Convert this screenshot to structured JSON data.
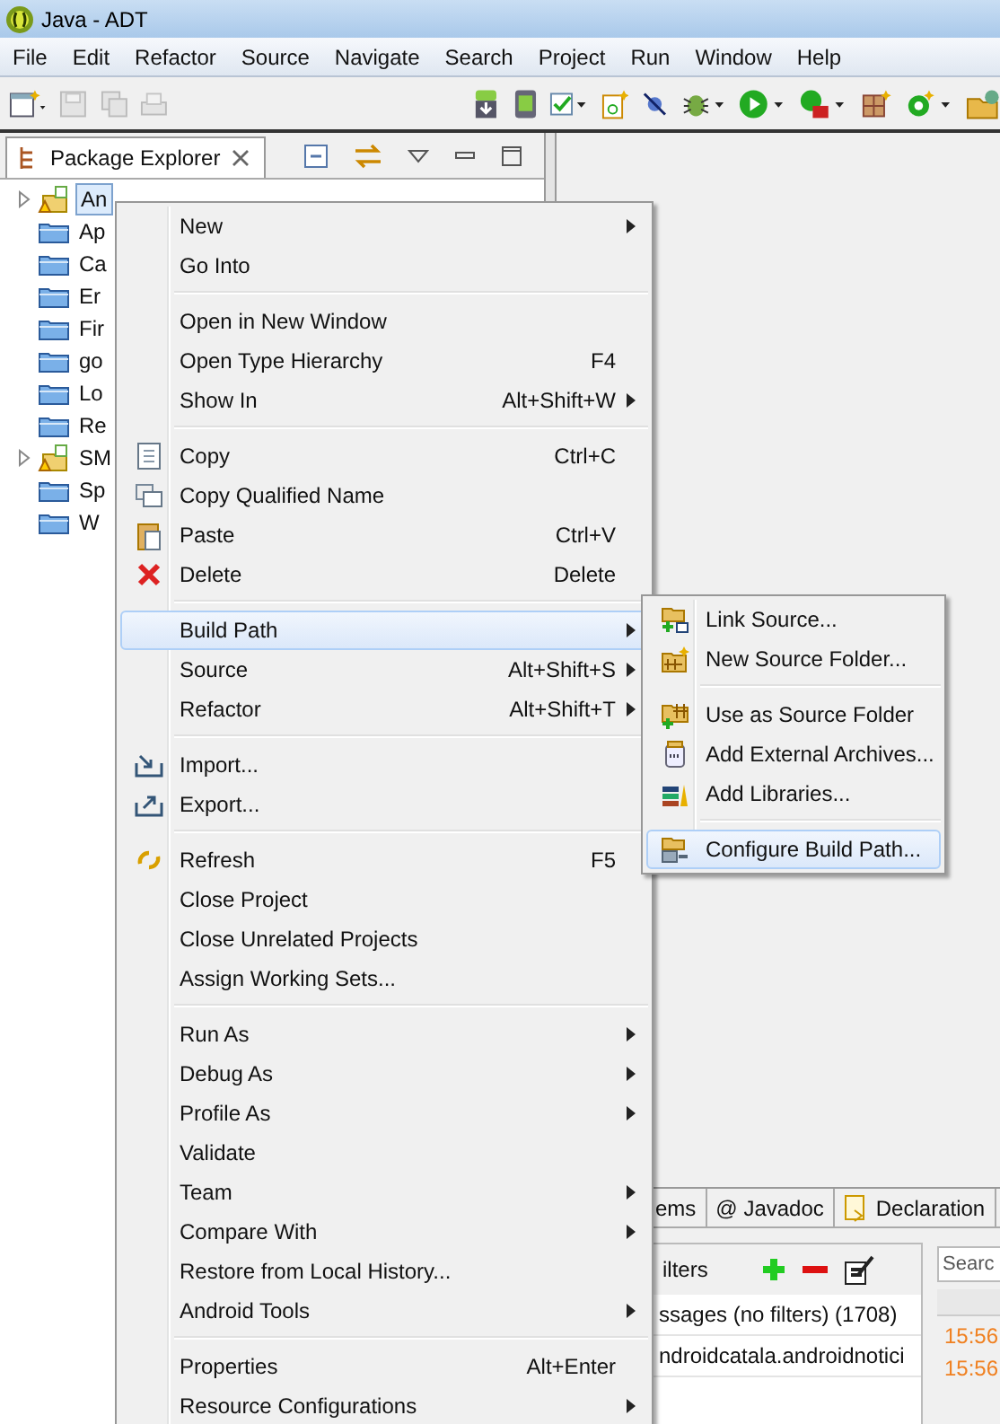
{
  "window": {
    "title": "Java - ADT"
  },
  "menu_bar": [
    "File",
    "Edit",
    "Refactor",
    "Source",
    "Navigate",
    "Search",
    "Project",
    "Run",
    "Window",
    "Help"
  ],
  "package_explorer": {
    "title": "Package Explorer",
    "items": [
      {
        "label": "An",
        "kind": "project",
        "expandable": true,
        "selected": true
      },
      {
        "label": "Ap",
        "kind": "folder",
        "expandable": false,
        "selected": false
      },
      {
        "label": "Ca",
        "kind": "folder",
        "expandable": false,
        "selected": false
      },
      {
        "label": "Er",
        "kind": "folder",
        "expandable": false,
        "selected": false
      },
      {
        "label": "Fir",
        "kind": "folder",
        "expandable": false,
        "selected": false
      },
      {
        "label": "go",
        "kind": "folder",
        "expandable": false,
        "selected": false
      },
      {
        "label": "Lo",
        "kind": "folder",
        "expandable": false,
        "selected": false
      },
      {
        "label": "Re",
        "kind": "folder",
        "expandable": false,
        "selected": false
      },
      {
        "label": "SM",
        "kind": "project",
        "expandable": true,
        "selected": false
      },
      {
        "label": "Sp",
        "kind": "folder",
        "expandable": false,
        "selected": false
      },
      {
        "label": "W",
        "kind": "folder",
        "expandable": false,
        "selected": false
      }
    ]
  },
  "context_menu": [
    [
      {
        "label": "New",
        "submenu": true,
        "selected": false
      },
      {
        "label": "Go Into",
        "submenu": false,
        "selected": false
      }
    ],
    [
      {
        "label": "Open in New Window",
        "submenu": false,
        "selected": false
      },
      {
        "label": "Open Type Hierarchy",
        "shortcut": "F4",
        "submenu": false,
        "selected": false
      },
      {
        "label": "Show In",
        "shortcut": "Alt+Shift+W",
        "submenu": true,
        "selected": false
      }
    ],
    [
      {
        "label": "Copy",
        "shortcut": "Ctrl+C",
        "submenu": false,
        "selected": false
      },
      {
        "label": "Copy Qualified Name",
        "submenu": false,
        "selected": false
      },
      {
        "label": "Paste",
        "shortcut": "Ctrl+V",
        "submenu": false,
        "selected": false
      },
      {
        "label": "Delete",
        "shortcut": "Delete",
        "submenu": false,
        "selected": false
      }
    ],
    [
      {
        "label": "Build Path",
        "submenu": true,
        "selected": true
      },
      {
        "label": "Source",
        "shortcut": "Alt+Shift+S",
        "submenu": true,
        "selected": false
      },
      {
        "label": "Refactor",
        "shortcut": "Alt+Shift+T",
        "submenu": true,
        "selected": false
      }
    ],
    [
      {
        "label": "Import...",
        "submenu": false,
        "selected": false
      },
      {
        "label": "Export...",
        "submenu": false,
        "selected": false
      }
    ],
    [
      {
        "label": "Refresh",
        "shortcut": "F5",
        "submenu": false,
        "selected": false
      },
      {
        "label": "Close Project",
        "submenu": false,
        "selected": false
      },
      {
        "label": "Close Unrelated Projects",
        "submenu": false,
        "selected": false
      },
      {
        "label": "Assign Working Sets...",
        "submenu": false,
        "selected": false
      }
    ],
    [
      {
        "label": "Run As",
        "submenu": true,
        "selected": false
      },
      {
        "label": "Debug As",
        "submenu": true,
        "selected": false
      },
      {
        "label": "Profile As",
        "submenu": true,
        "selected": false
      },
      {
        "label": "Validate",
        "submenu": false,
        "selected": false
      },
      {
        "label": "Team",
        "submenu": true,
        "selected": false
      },
      {
        "label": "Compare With",
        "submenu": true,
        "selected": false
      },
      {
        "label": "Restore from Local History...",
        "submenu": false,
        "selected": false
      },
      {
        "label": "Android Tools",
        "submenu": true,
        "selected": false
      }
    ],
    [
      {
        "label": "Properties",
        "shortcut": "Alt+Enter",
        "submenu": false,
        "selected": false
      },
      {
        "label": "Resource Configurations",
        "submenu": true,
        "selected": false
      }
    ]
  ],
  "build_path_submenu": [
    [
      {
        "label": "Link Source...",
        "selected": false
      },
      {
        "label": "New Source Folder...",
        "selected": false
      }
    ],
    [
      {
        "label": "Use as Source Folder",
        "selected": false
      },
      {
        "label": "Add External Archives...",
        "selected": false
      },
      {
        "label": "Add Libraries...",
        "selected": false
      }
    ],
    [
      {
        "label": "Configure Build Path...",
        "selected": true
      }
    ]
  ],
  "bottom_tabs": [
    {
      "label": "ems"
    },
    {
      "label": "@ Javadoc"
    },
    {
      "label": "Declaration"
    }
  ],
  "logcat": {
    "filters_title": "ilters",
    "filters": [
      "ssages (no filters) (1708)",
      "ndroidcatala.androidnotici"
    ],
    "search": {
      "placeholder": "Searc"
    },
    "times": [
      "15:56",
      "15:56"
    ]
  }
}
